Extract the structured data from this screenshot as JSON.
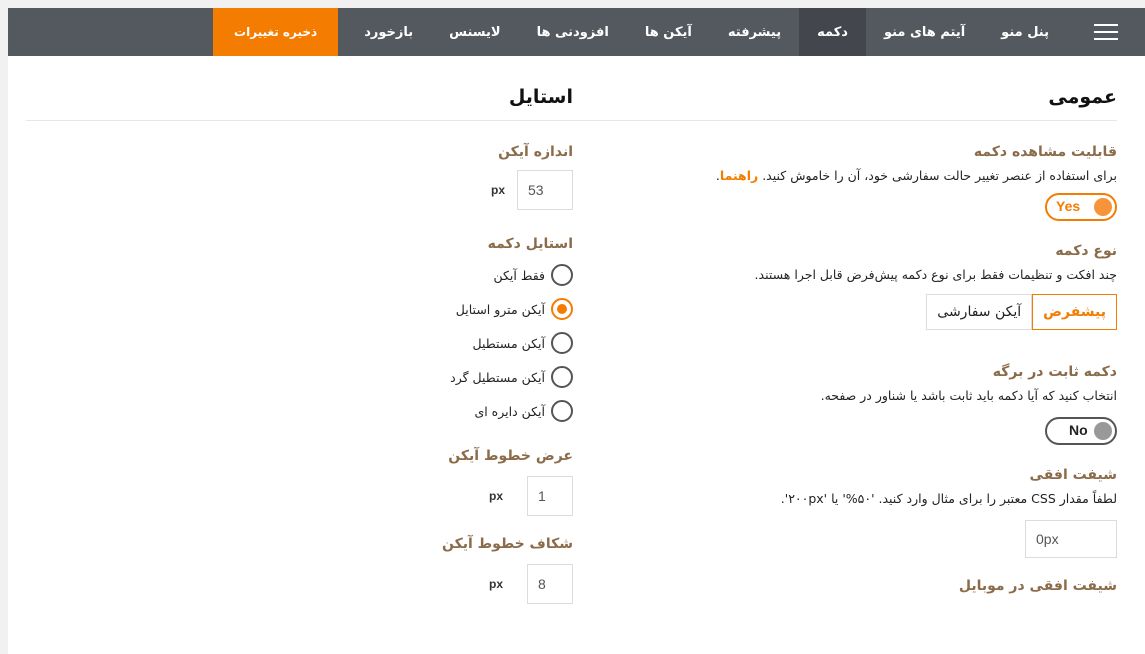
{
  "nav": {
    "tabs": [
      {
        "label": "پنل منو"
      },
      {
        "label": "آیتم های منو"
      },
      {
        "label": "دکمه",
        "active": true
      },
      {
        "label": "پیشرفته"
      },
      {
        "label": "آیکن ها"
      },
      {
        "label": "افزودنی ها"
      },
      {
        "label": "لایسنس"
      },
      {
        "label": "بازخورد"
      }
    ],
    "save_label": "ذخیره تغییرات"
  },
  "general": {
    "title": "عمومی",
    "visibility": {
      "label": "قابلیت مشاهده دکمه",
      "desc": "برای استفاده از عنصر تغییر حالت سفارشی خود، آن را خاموش کنید.",
      "link": "راهنما",
      "toggle": "Yes"
    },
    "button_type": {
      "label": "نوع دکمه",
      "desc": "چند افکت و تنظیمات فقط برای نوع دکمه پیش‌فرض قابل اجرا هستند.",
      "options": [
        "پیشفرض",
        "آیکن سفارشی"
      ],
      "selected": "پیشفرض"
    },
    "fixed": {
      "label": "دکمه ثابت در برگه",
      "desc": "انتخاب کنید که آیا دکمه باید ثابت باشد یا شناور در صفحه.",
      "toggle": "No"
    },
    "h_shift": {
      "label": "شیفت افقی",
      "desc": "لطفاً مقدار CSS معتبر را برای مثال وارد کنید. '۵۰%' یا '۲۰۰px'.",
      "value": "0px"
    },
    "h_shift_mobile": {
      "label": "شیفت افقی در موبایل"
    }
  },
  "style": {
    "title": "استایل",
    "icon_size": {
      "label": "اندازه آیکن",
      "value": "53",
      "unit": "px"
    },
    "button_style": {
      "label": "استایل دکمه",
      "options": [
        "فقط آیکن",
        "آیکن مترو استایل",
        "آیکن مستطیل",
        "آیکن مستطیل گرد",
        "آیکن دایره ای"
      ],
      "selected": "آیکن مترو استایل"
    },
    "line_width": {
      "label": "عرض خطوط آیکن",
      "value": "1",
      "unit": "px"
    },
    "line_gap": {
      "label": "شکاف خطوط آیکن",
      "value": "8",
      "unit": "px"
    }
  },
  "colors": {
    "accent": "#f47c00",
    "topbar": "#545960",
    "label": "#8a6b4a"
  }
}
